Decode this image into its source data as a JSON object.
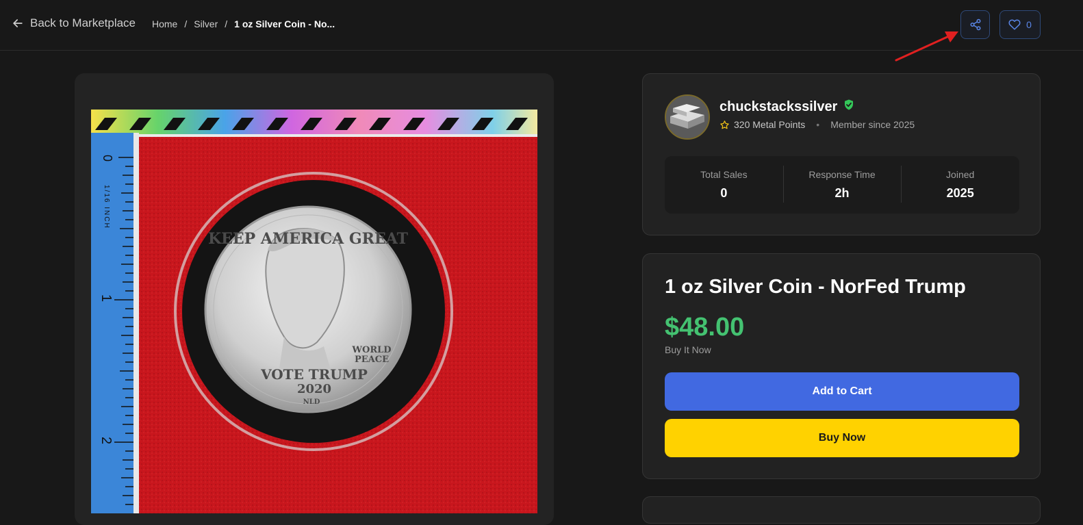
{
  "header": {
    "back_label": "Back to Marketplace",
    "breadcrumb": [
      "Home",
      "Silver",
      "1 oz Silver Coin - No..."
    ],
    "breadcrumb_sep": "/",
    "like_count": "0"
  },
  "product_image": {
    "coin_text_top": "KEEP AMERICA GREAT",
    "coin_text_right": [
      "WORLD",
      "PEACE"
    ],
    "coin_text_bottom": [
      "VOTE TRUMP",
      "2020"
    ],
    "coin_mark": "NLD",
    "ruler_numbers": [
      "0",
      "1",
      "2"
    ],
    "ruler_label": "1/16 INCH"
  },
  "seller": {
    "name": "chuckstackssilver",
    "points": "320 Metal Points",
    "member_since": "Member since 2025",
    "stats": [
      {
        "label": "Total Sales",
        "value": "0"
      },
      {
        "label": "Response Time",
        "value": "2h"
      },
      {
        "label": "Joined",
        "value": "2025"
      }
    ]
  },
  "product": {
    "title": "1 oz Silver Coin - NorFed Trump",
    "price": "$48.00",
    "listing_type": "Buy It Now",
    "add_to_cart_label": "Add to Cart",
    "buy_now_label": "Buy Now"
  },
  "colors": {
    "price": "#44c271",
    "primary": "#4169e1",
    "buy": "#ffd200",
    "verified": "#34c759",
    "annotation": "#e02020"
  }
}
